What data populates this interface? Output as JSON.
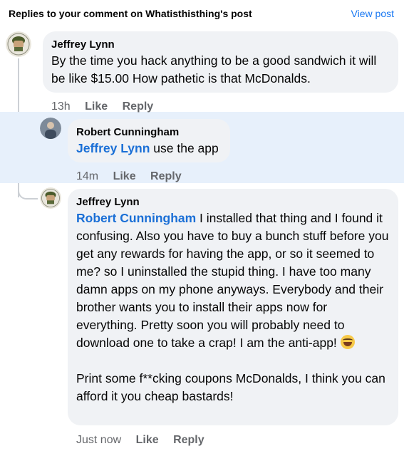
{
  "header": {
    "title": "Replies to your comment on Whatisthisthing's post",
    "view_post": "View post"
  },
  "comments": [
    {
      "author": "Jeffrey Lynn",
      "text": "By the time you hack anything to be a good sandwich it will be like $15.00  How pathetic is that McDonalds.",
      "time": "13h",
      "like": "Like",
      "reply": "Reply"
    },
    {
      "author": "Robert Cunningham",
      "mention": "Jeffrey Lynn",
      "text": " use the app",
      "time": "14m",
      "like": "Like",
      "reply": "Reply"
    },
    {
      "author": "Jeffrey Lynn",
      "mention": "Robert Cunningham",
      "text": " I installed that thing and I found it confusing. Also you have to buy a bunch stuff before you get any rewards for having the app, or so it seemed to me? so I uninstalled the stupid thing. I have too many damn apps on my phone anyways. Everybody and their brother wants you to install their apps now for everything. Pretty soon you will probably need to download one to take a crap! I am the anti-app! ",
      "text2": "Print some f**cking coupons McDonalds, I think you can afford it you cheap bastards!",
      "time": "Just now",
      "like": "Like",
      "reply": "Reply"
    }
  ],
  "icons": {
    "avatar_jeffrey": "soldier-avatar",
    "avatar_robert": "person-avatar",
    "emoji": "laughing-crying-emoji"
  }
}
